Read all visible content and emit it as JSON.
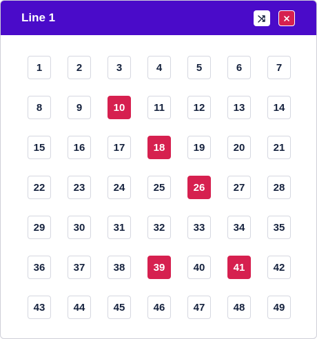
{
  "header": {
    "title": "Line 1",
    "shuffle_icon": "shuffle-icon",
    "close_icon": "close-icon"
  },
  "colors": {
    "header_bg": "#4a0bc9",
    "selected": "#d6204f",
    "number_text": "#14213d"
  },
  "numbers": {
    "values": [
      "1",
      "2",
      "3",
      "4",
      "5",
      "6",
      "7",
      "8",
      "9",
      "10",
      "11",
      "12",
      "13",
      "14",
      "15",
      "16",
      "17",
      "18",
      "19",
      "20",
      "21",
      "22",
      "23",
      "24",
      "25",
      "26",
      "27",
      "28",
      "29",
      "30",
      "31",
      "32",
      "33",
      "34",
      "35",
      "36",
      "37",
      "38",
      "39",
      "40",
      "41",
      "42",
      "43",
      "44",
      "45",
      "46",
      "47",
      "48",
      "49"
    ],
    "selected": [
      "10",
      "18",
      "26",
      "39",
      "41"
    ]
  }
}
